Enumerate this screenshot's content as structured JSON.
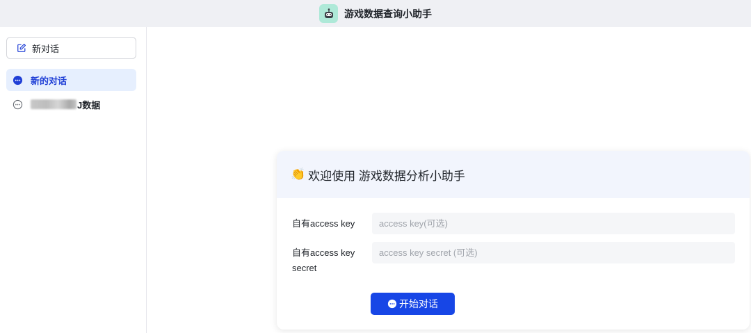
{
  "app": {
    "title": "游戏数据查询小助手",
    "logo_icon": "robot-icon"
  },
  "sidebar": {
    "new_chat_label": "新对话",
    "conversations": [
      {
        "label": "新的对话",
        "active": true
      },
      {
        "label_visible_suffix": "J数据",
        "active": false,
        "redacted": true
      }
    ]
  },
  "welcome": {
    "emoji": "👏",
    "title": "欢迎使用 游戏数据分析小助手",
    "fields": [
      {
        "label": "自有access key",
        "placeholder": "access key(可选)"
      },
      {
        "label": "自有access key secret",
        "placeholder": "access key secret (可选)"
      }
    ],
    "start_button": "开始对话"
  },
  "colors": {
    "accent": "#1746e6",
    "active_bg": "#e6effe",
    "header_bg": "#f2f5fd",
    "topbar_bg": "#eff0f4"
  }
}
